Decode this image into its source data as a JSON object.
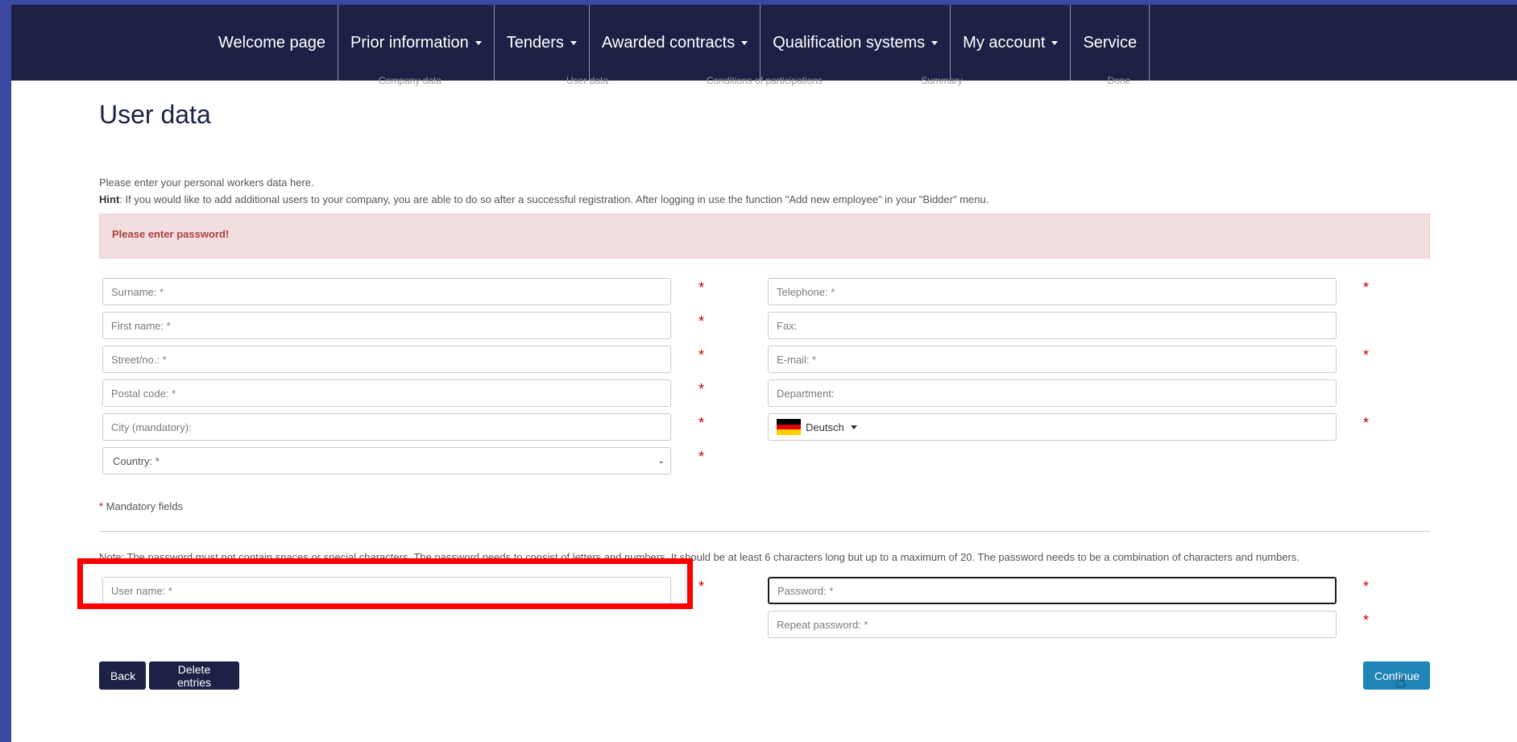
{
  "nav": {
    "items": [
      {
        "label": "Welcome page",
        "has_dropdown": false
      },
      {
        "label": "Prior information",
        "has_dropdown": true
      },
      {
        "label": "Tenders",
        "has_dropdown": true
      },
      {
        "label": "Awarded contracts",
        "has_dropdown": true
      },
      {
        "label": "Qualification systems",
        "has_dropdown": true
      },
      {
        "label": "My account",
        "has_dropdown": true
      },
      {
        "label": "Service",
        "has_dropdown": false
      }
    ]
  },
  "steps": [
    "Company data",
    "User data",
    "Conditions of participations",
    "Summary",
    "Done"
  ],
  "page": {
    "title": "User data",
    "intro_line1": "Please enter your personal workers data here.",
    "hint_label": "Hint",
    "hint_text": ": If you would like to add additional users to your company, you are able to do so after a successful registration. After logging in use the function \"Add new employee\" in your \"Bidder\" menu."
  },
  "alert": {
    "message": "Please enter password!"
  },
  "form": {
    "surname_placeholder": "Surname: *",
    "first_name_placeholder": "First name: *",
    "street_placeholder": "Street/no.: *",
    "postal_placeholder": "Postal code: *",
    "city_placeholder": "City (mandatory):",
    "country_selected": "Country: *",
    "telephone_placeholder": "Telephone: *",
    "fax_placeholder": "Fax:",
    "email_placeholder": "E-mail: *",
    "department_placeholder": "Department:",
    "language_selected": "Deutsch",
    "required_marker": "*",
    "mandatory_star": "*",
    "mandatory_text": " Mandatory fields",
    "password_note": "Note: The password must not contain spaces or special characters. The password needs to consist of letters and numbers. It should be at least 6 characters long but up to a maximum of 20. The password needs to be a combination of characters and numbers.",
    "username_placeholder": "User name: *",
    "password_placeholder": "Password: *",
    "repeat_password_placeholder": "Repeat password: *"
  },
  "buttons": {
    "back": "Back",
    "delete": "Delete entries",
    "continue": "Continue"
  },
  "colors": {
    "navbar": "#1c2145",
    "alert_bg": "#f2dede",
    "alert_text": "#a94442",
    "required": "#cc0000",
    "continue_button": "#1f84b6",
    "highlight_box": "#ff0000"
  },
  "icons": {
    "flag": "germany-flag-icon",
    "dropdown": "caret-down-icon",
    "cursor": "hand-pointer-icon"
  }
}
